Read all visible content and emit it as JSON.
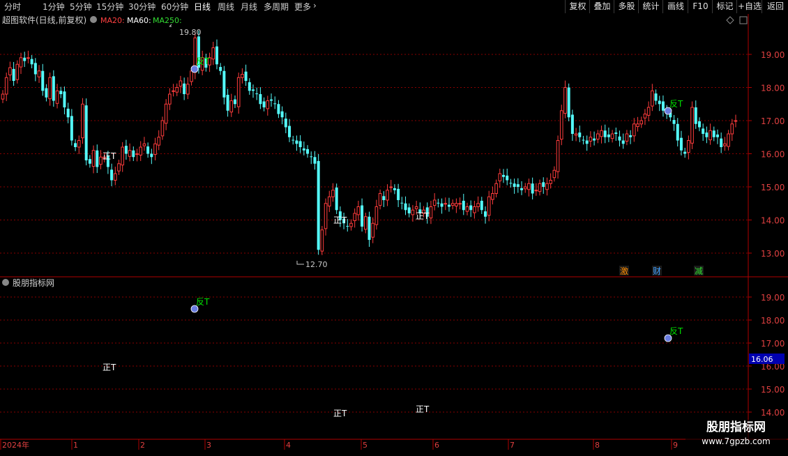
{
  "toolbar": {
    "timeframes": [
      "分时",
      "1分钟",
      "5分钟",
      "15分钟",
      "30分钟",
      "60分钟",
      "日线",
      "周线",
      "月线",
      "多周期",
      "更多"
    ],
    "active": "日线",
    "right_buttons": [
      "复权",
      "叠加",
      "多股",
      "统计",
      "画线",
      "F10",
      "标记",
      "+自选",
      "返回"
    ]
  },
  "chart_header": {
    "title": "超图软件(日线,前复权)",
    "ma20": "MA20:",
    "ma60": "MA60:",
    "ma250": "MA250:"
  },
  "indicator_header": {
    "title": "股朋指标网"
  },
  "price_labels": {
    "high": "19.80",
    "low": "12.70"
  },
  "current_value": "16.06",
  "badges": [
    "激",
    "财",
    "减"
  ],
  "signals": {
    "buy_label": "正T",
    "sell_label": "反T"
  },
  "watermark": {
    "line1": "股朋指标网",
    "line2": "www.7gpzb.com"
  },
  "colors": {
    "up": "#ff3c3c",
    "down": "#54fcfc",
    "grid": "#8a0000",
    "background": "#000000",
    "sell_signal": "#00e000",
    "buy_signal": "#ffffff"
  },
  "chart_data": {
    "type": "candlestick",
    "y_axis_main": [
      19.0,
      18.0,
      17.0,
      16.0,
      15.0,
      14.0,
      13.0
    ],
    "y_axis_indicator": [
      19.0,
      18.0,
      17.0,
      16.0,
      15.0,
      14.0
    ],
    "x_axis_labels": [
      "2024年",
      "1",
      "2",
      "3",
      "4",
      "5",
      "6",
      "7",
      "8",
      "9"
    ],
    "ylim_main": [
      12.5,
      20.2
    ],
    "ylim_indicator": [
      13.75,
      19.6
    ],
    "closes": [
      17.8,
      18.3,
      18.6,
      18.2,
      18.7,
      18.9,
      18.8,
      18.9,
      18.7,
      18.4,
      18.5,
      17.9,
      17.7,
      18.3,
      17.6,
      17.9,
      17.8,
      17.4,
      17.1,
      16.4,
      16.2,
      16.4,
      17.5,
      15.8,
      15.7,
      16.1,
      15.6,
      15.9,
      15.9,
      15.6,
      15.2,
      15.4,
      15.7,
      16.2,
      16.0,
      16.1,
      15.9,
      16.0,
      16.2,
      16.3,
      16.0,
      15.9,
      16.3,
      16.5,
      17.0,
      17.5,
      17.8,
      17.9,
      18.0,
      18.2,
      17.8,
      18.1,
      18.5,
      19.5,
      18.6,
      18.9,
      18.6,
      18.9,
      19.2,
      18.7,
      18.5,
      17.7,
      17.3,
      17.6,
      17.5,
      18.3,
      18.4,
      18.2,
      17.9,
      17.9,
      17.8,
      17.5,
      17.4,
      17.6,
      17.6,
      17.5,
      17.2,
      17.1,
      16.8,
      16.5,
      16.4,
      16.3,
      16.2,
      16.1,
      16.0,
      15.9,
      15.7,
      13.1,
      13.7,
      14.5,
      14.7,
      14.9,
      14.3,
      14.0,
      13.9,
      13.8,
      13.9,
      14.2,
      14.4,
      13.8,
      14.1,
      13.4,
      13.9,
      14.4,
      14.8,
      14.6,
      14.9,
      15.0,
      14.9,
      14.6,
      14.5,
      14.3,
      14.2,
      14.3,
      14.4,
      14.2,
      14.3,
      14.1,
      14.4,
      14.6,
      14.5,
      14.4,
      14.5,
      14.4,
      14.5,
      14.5,
      14.5,
      14.3,
      14.4,
      14.3,
      14.4,
      14.5,
      14.3,
      14.1,
      14.7,
      14.8,
      15.1,
      15.4,
      15.3,
      15.2,
      15.1,
      15.0,
      15.0,
      14.9,
      15.0,
      15.1,
      14.8,
      14.9,
      15.1,
      15.0,
      15.1,
      15.2,
      15.5,
      16.4,
      17.3,
      18.0,
      17.1,
      16.6,
      16.6,
      16.5,
      16.4,
      16.3,
      16.5,
      16.4,
      16.6,
      16.7,
      16.5,
      16.5,
      16.6,
      16.6,
      16.4,
      16.3,
      16.6,
      16.5,
      16.9,
      16.9,
      17.0,
      17.2,
      17.4,
      17.9,
      17.6,
      17.5,
      17.3,
      17.2,
      17.1,
      16.9,
      16.4,
      16.1,
      16.0,
      16.4,
      17.4,
      16.9,
      16.8,
      16.6,
      16.5,
      16.7,
      16.5,
      16.5,
      16.2,
      16.3,
      16.6,
      16.9,
      17.0
    ]
  }
}
